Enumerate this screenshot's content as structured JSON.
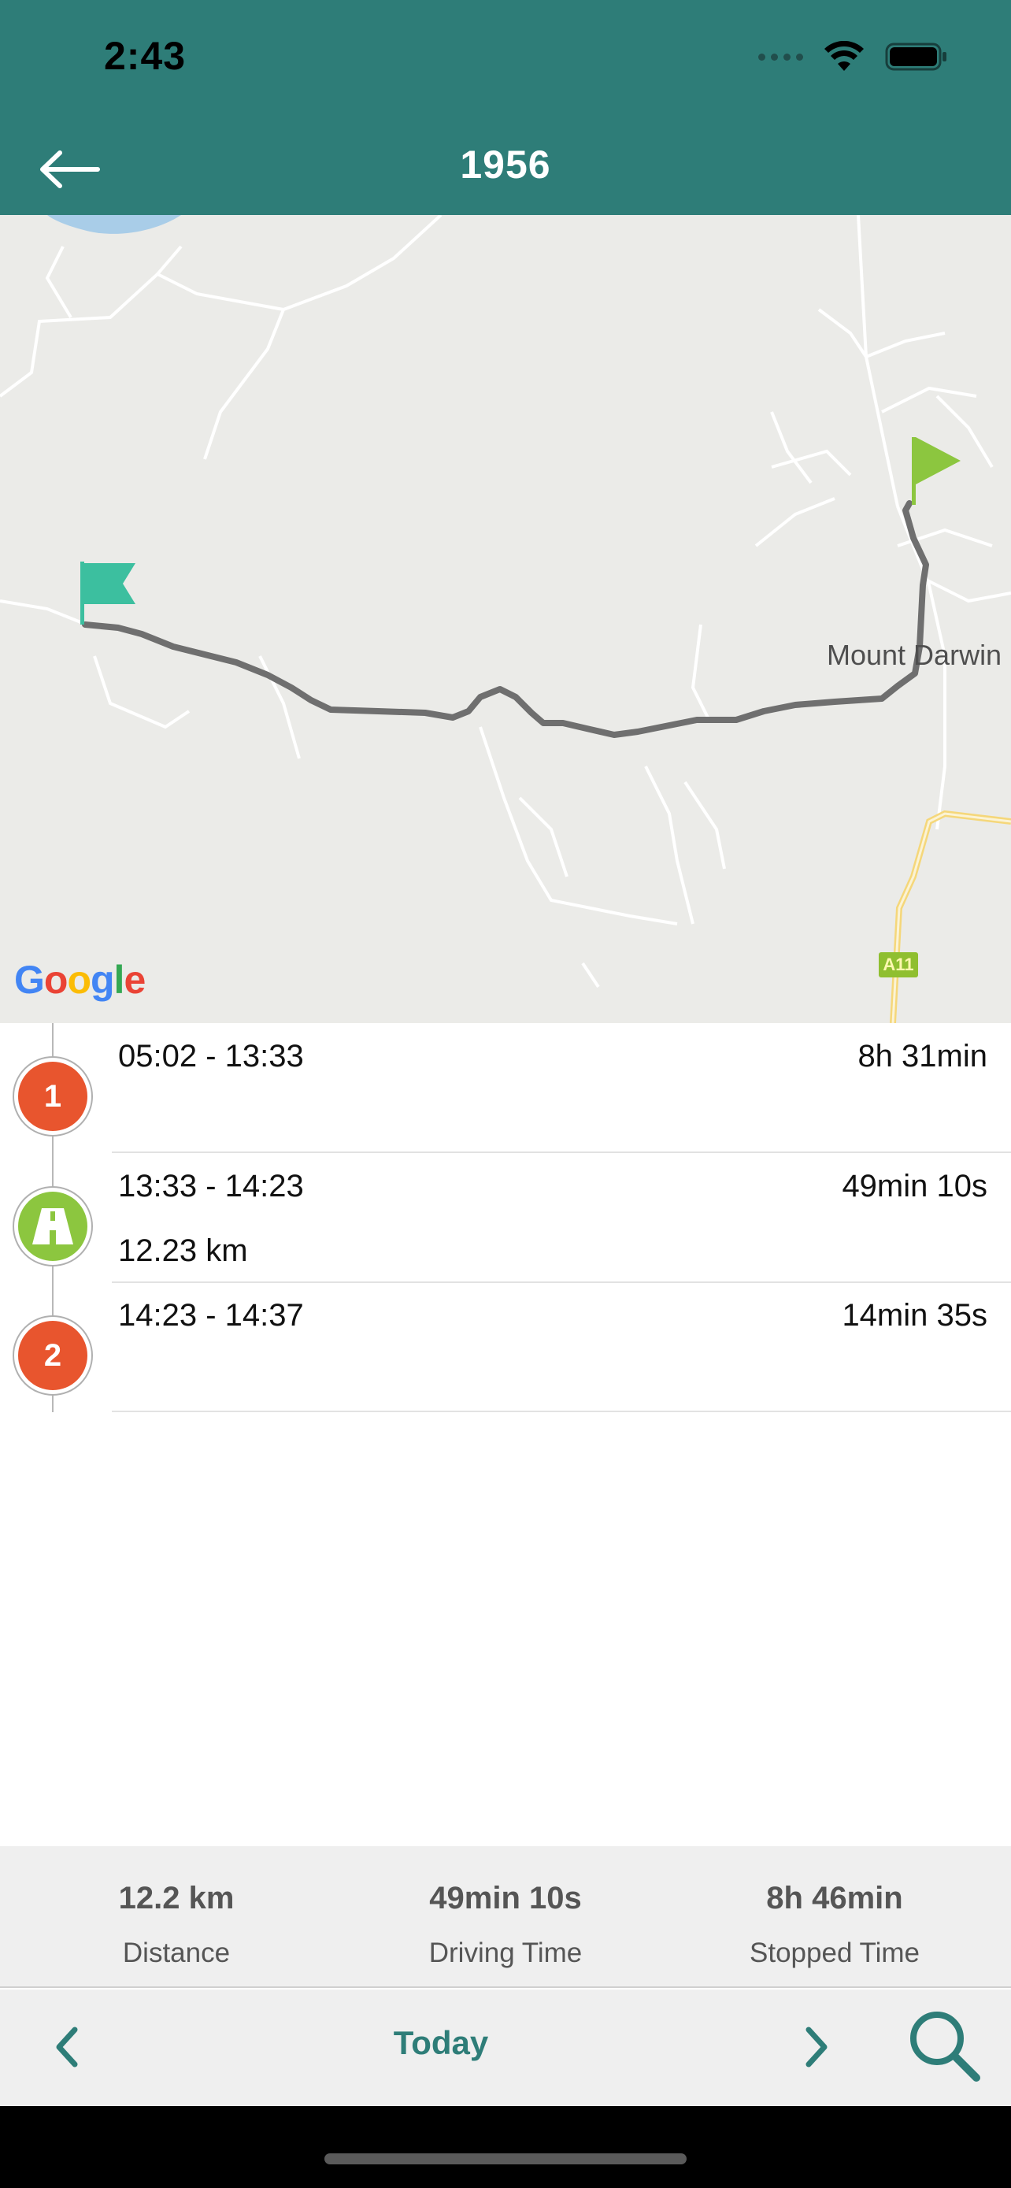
{
  "status_bar": {
    "time": "2:43"
  },
  "header": {
    "title": "1956",
    "back_icon": "arrow-left-icon"
  },
  "map": {
    "place_label": "Mount Darwin",
    "road_label": "A11",
    "attribution": {
      "G": "G",
      "o1": "o",
      "o2": "o",
      "g": "g",
      "l": "l",
      "e": "e"
    },
    "colors": {
      "route": "#6f6f6f",
      "start_flag": "#3cbf9f",
      "end_flag": "#8cc63f",
      "land": "#ebebe8",
      "road": "#ffffff",
      "highway": "#f5d77a"
    }
  },
  "timeline": [
    {
      "type": "stop",
      "badge": "1",
      "time_range": "05:02 - 13:33",
      "duration": "8h 31min",
      "distance": ""
    },
    {
      "type": "drive",
      "badge_icon": "road-icon",
      "time_range": "13:33 - 14:23",
      "duration": "49min 10s",
      "distance": "12.23 km"
    },
    {
      "type": "stop",
      "badge": "2",
      "time_range": "14:23 - 14:37",
      "duration": "14min 35s",
      "distance": ""
    }
  ],
  "summary": {
    "distance": {
      "value": "12.2 km",
      "label": "Distance"
    },
    "driving_time": {
      "value": "49min 10s",
      "label": "Driving Time"
    },
    "stopped_time": {
      "value": "8h 46min",
      "label": "Stopped Time"
    }
  },
  "nav": {
    "today_label": "Today",
    "prev_icon": "chevron-left-icon",
    "next_icon": "chevron-right-icon",
    "search_icon": "search-icon"
  },
  "colors": {
    "header": "#2e7d78",
    "accent": "#2e7d78",
    "stop_badge": "#e8552e",
    "drive_badge": "#8cc63f"
  }
}
